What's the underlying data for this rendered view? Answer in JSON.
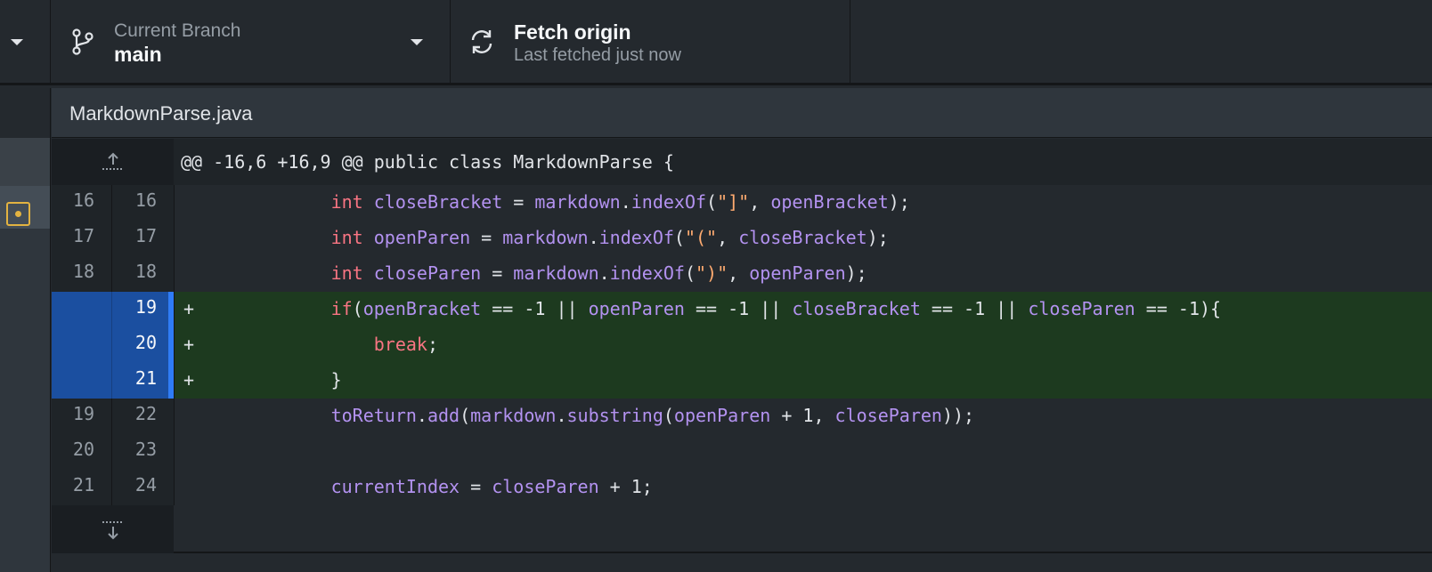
{
  "toolbar": {
    "branch": {
      "label": "Current Branch",
      "value": "main"
    },
    "fetch": {
      "title": "Fetch origin",
      "subtitle": "Last fetched just now"
    }
  },
  "file": {
    "name": "MarkdownParse.java"
  },
  "diff": {
    "hunk_header": "@@ -16,6 +16,9 @@ public class MarkdownParse {",
    "lines": [
      {
        "type": "context",
        "old": "16",
        "new": "16",
        "marker": "",
        "indent": "            ",
        "tokens": [
          {
            "t": "kw",
            "v": "int"
          },
          {
            "t": "op",
            "v": " "
          },
          {
            "t": "var",
            "v": "closeBracket"
          },
          {
            "t": "op",
            "v": " = "
          },
          {
            "t": "var",
            "v": "markdown"
          },
          {
            "t": "op",
            "v": "."
          },
          {
            "t": "var",
            "v": "indexOf"
          },
          {
            "t": "op",
            "v": "("
          },
          {
            "t": "str",
            "v": "\"]\""
          },
          {
            "t": "op",
            "v": ", "
          },
          {
            "t": "var",
            "v": "openBracket"
          },
          {
            "t": "op",
            "v": ");"
          }
        ]
      },
      {
        "type": "context",
        "old": "17",
        "new": "17",
        "marker": "",
        "indent": "            ",
        "tokens": [
          {
            "t": "kw",
            "v": "int"
          },
          {
            "t": "op",
            "v": " "
          },
          {
            "t": "var",
            "v": "openParen"
          },
          {
            "t": "op",
            "v": " = "
          },
          {
            "t": "var",
            "v": "markdown"
          },
          {
            "t": "op",
            "v": "."
          },
          {
            "t": "var",
            "v": "indexOf"
          },
          {
            "t": "op",
            "v": "("
          },
          {
            "t": "str",
            "v": "\"(\""
          },
          {
            "t": "op",
            "v": ", "
          },
          {
            "t": "var",
            "v": "closeBracket"
          },
          {
            "t": "op",
            "v": ");"
          }
        ]
      },
      {
        "type": "context",
        "old": "18",
        "new": "18",
        "marker": "",
        "indent": "            ",
        "tokens": [
          {
            "t": "kw",
            "v": "int"
          },
          {
            "t": "op",
            "v": " "
          },
          {
            "t": "var",
            "v": "closeParen"
          },
          {
            "t": "op",
            "v": " = "
          },
          {
            "t": "var",
            "v": "markdown"
          },
          {
            "t": "op",
            "v": "."
          },
          {
            "t": "var",
            "v": "indexOf"
          },
          {
            "t": "op",
            "v": "("
          },
          {
            "t": "str",
            "v": "\")\""
          },
          {
            "t": "op",
            "v": ", "
          },
          {
            "t": "var",
            "v": "openParen"
          },
          {
            "t": "op",
            "v": ");"
          }
        ]
      },
      {
        "type": "add",
        "old": "",
        "new": "19",
        "marker": "+",
        "indent": "            ",
        "tokens": [
          {
            "t": "kw",
            "v": "if"
          },
          {
            "t": "op",
            "v": "("
          },
          {
            "t": "var",
            "v": "openBracket"
          },
          {
            "t": "op",
            "v": " == -1 || "
          },
          {
            "t": "var",
            "v": "openParen"
          },
          {
            "t": "op",
            "v": " == -1 || "
          },
          {
            "t": "var",
            "v": "closeBracket"
          },
          {
            "t": "op",
            "v": " == -1 || "
          },
          {
            "t": "var",
            "v": "closeParen"
          },
          {
            "t": "op",
            "v": " == -1){"
          }
        ]
      },
      {
        "type": "add",
        "old": "",
        "new": "20",
        "marker": "+",
        "indent": "                ",
        "tokens": [
          {
            "t": "kw",
            "v": "break"
          },
          {
            "t": "op",
            "v": ";"
          }
        ]
      },
      {
        "type": "add",
        "old": "",
        "new": "21",
        "marker": "+",
        "indent": "            ",
        "tokens": [
          {
            "t": "op",
            "v": "}"
          }
        ]
      },
      {
        "type": "context",
        "old": "19",
        "new": "22",
        "marker": "",
        "indent": "            ",
        "tokens": [
          {
            "t": "var",
            "v": "toReturn"
          },
          {
            "t": "op",
            "v": "."
          },
          {
            "t": "var",
            "v": "add"
          },
          {
            "t": "op",
            "v": "("
          },
          {
            "t": "var",
            "v": "markdown"
          },
          {
            "t": "op",
            "v": "."
          },
          {
            "t": "var",
            "v": "substring"
          },
          {
            "t": "op",
            "v": "("
          },
          {
            "t": "var",
            "v": "openParen"
          },
          {
            "t": "op",
            "v": " + 1, "
          },
          {
            "t": "var",
            "v": "closeParen"
          },
          {
            "t": "op",
            "v": "));"
          }
        ]
      },
      {
        "type": "context",
        "old": "20",
        "new": "23",
        "marker": "",
        "indent": "",
        "tokens": []
      },
      {
        "type": "context",
        "old": "21",
        "new": "24",
        "marker": "",
        "indent": "            ",
        "tokens": [
          {
            "t": "var",
            "v": "currentIndex"
          },
          {
            "t": "op",
            "v": " = "
          },
          {
            "t": "var",
            "v": "closeParen"
          },
          {
            "t": "op",
            "v": " + 1;"
          }
        ]
      }
    ]
  },
  "colors": {
    "added_bg": "#1d3a1f",
    "selected_gutter": "#1b4fa0",
    "keyword": "#f97583",
    "identifier": "#b392f0",
    "string": "#ffab70",
    "file_status": "#e3b341"
  },
  "icons": {
    "branch": "git-branch-icon",
    "fetch": "sync-icon",
    "file_status": "file-modified-icon",
    "expand_up": "expand-up-icon",
    "expand_down": "expand-down-icon"
  }
}
